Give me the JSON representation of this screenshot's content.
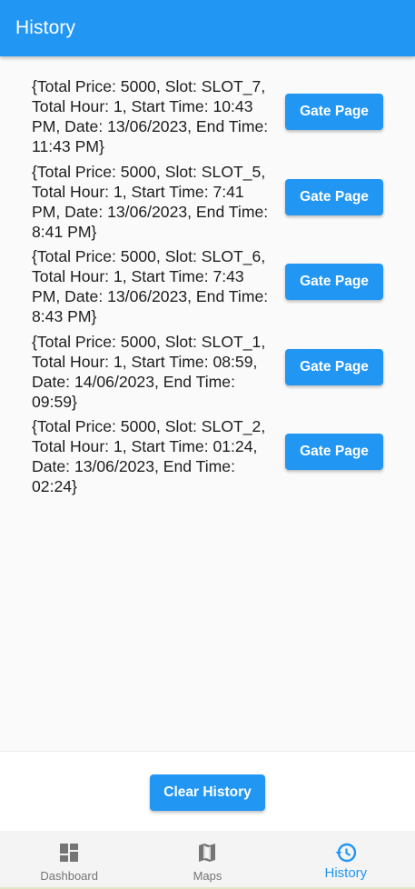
{
  "app_bar": {
    "title": "History"
  },
  "history": [
    {
      "text": "{Total Price: 5000, Slot: SLOT_7, Total Hour: 1, Start Time: 10:43 PM, Date: 13/06/2023, End Time: 11:43 PM}",
      "button": "Gate Page"
    },
    {
      "text": "{Total Price: 5000, Slot: SLOT_5, Total Hour: 1, Start Time: 7:41 PM, Date: 13/06/2023, End Time: 8:41 PM}",
      "button": "Gate Page"
    },
    {
      "text": "{Total Price: 5000, Slot: SLOT_6, Total Hour: 1, Start Time: 7:43 PM, Date: 13/06/2023, End Time: 8:43 PM}",
      "button": "Gate Page"
    },
    {
      "text": "{Total Price: 5000, Slot: SLOT_1, Total Hour: 1, Start Time: 08:59, Date: 14/06/2023, End Time: 09:59}",
      "button": "Gate Page"
    },
    {
      "text": "{Total Price: 5000, Slot: SLOT_2, Total Hour: 1, Start Time: 01:24, Date: 13/06/2023, End Time: 02:24}",
      "button": "Gate Page"
    }
  ],
  "clear_button": "Clear History",
  "nav": {
    "active": "history",
    "items": [
      {
        "label": "Dashboard",
        "icon": "dashboard-icon"
      },
      {
        "label": "Maps",
        "icon": "map-icon"
      },
      {
        "label": "History",
        "icon": "history-icon"
      }
    ]
  },
  "colors": {
    "primary": "#2196f3",
    "background": "#fafafa",
    "text": "#1e1e1e",
    "nav_inactive": "#757575"
  }
}
